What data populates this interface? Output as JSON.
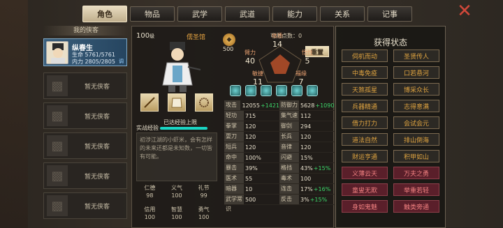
{
  "tabs": [
    "角色",
    "物品",
    "武学",
    "武道",
    "能力",
    "关系",
    "记事"
  ],
  "close_icon": "close-icon",
  "left": {
    "title": "我的侠客",
    "hero": {
      "name": "纵春生",
      "hp": "生命 5761/5761",
      "mp": "内力 2805/2805",
      "tag": "调"
    },
    "empty_label": "暂无侠客"
  },
  "center": {
    "level": "100",
    "level_unit": "级",
    "title": "儒圣馆",
    "exp_label": "实战经验",
    "exp_text": "已达经验上限",
    "exp_progress": 1.0,
    "bio": "初涉江湖的小虾米，会有怎样的未来还都是未知数，一切皆有可能。",
    "virtues": [
      {
        "name": "仁德",
        "value": "98"
      },
      {
        "name": "义气",
        "value": "100"
      },
      {
        "name": "礼节",
        "value": "99"
      },
      {
        "name": "信用",
        "value": "100"
      },
      {
        "name": "智慧",
        "value": "100"
      },
      {
        "name": "勇气",
        "value": "100"
      }
    ],
    "coin": "500",
    "points_label": "可用点数：",
    "points": "0",
    "reset_label": "重置",
    "attrs": {
      "tizhi": {
        "name": "体质",
        "value": "14"
      },
      "biili": {
        "name": "臂力",
        "value": "40"
      },
      "wuxing": {
        "name": "悟性",
        "value": "5"
      },
      "minjie": {
        "name": "敏捷",
        "value": "11"
      },
      "fuyuan": {
        "name": "福缘",
        "value": "7"
      }
    },
    "stats": [
      [
        {
          "k": "攻击力",
          "v": "12055",
          "up": "+1421"
        },
        {
          "k": "防御力",
          "v": "5628",
          "up": "+1090"
        }
      ],
      [
        {
          "k": "轻功",
          "v": "715",
          "up": ""
        },
        {
          "k": "集气速度",
          "v": "112",
          "up": ""
        }
      ],
      [
        {
          "k": "拳掌",
          "v": "120",
          "up": ""
        },
        {
          "k": "御剑",
          "v": "294",
          "up": ""
        }
      ],
      [
        {
          "k": "耍刀",
          "v": "120",
          "up": ""
        },
        {
          "k": "长兵",
          "v": "120",
          "up": ""
        }
      ],
      [
        {
          "k": "短兵",
          "v": "120",
          "up": ""
        },
        {
          "k": "音律",
          "v": "120",
          "up": ""
        }
      ],
      [
        {
          "k": "命中",
          "v": "100%",
          "up": ""
        },
        {
          "k": "闪避",
          "v": "15%",
          "up": ""
        }
      ],
      [
        {
          "k": "暴击",
          "v": "39%",
          "up": ""
        },
        {
          "k": "格挡",
          "v": "43%",
          "up": "+15%"
        }
      ],
      [
        {
          "k": "医术",
          "v": "55",
          "up": ""
        },
        {
          "k": "毒术",
          "v": "100",
          "up": ""
        }
      ],
      [
        {
          "k": "暗器",
          "v": "10",
          "up": ""
        },
        {
          "k": "连击",
          "v": "17%",
          "up": "+16%"
        }
      ],
      [
        {
          "k": "武学常识",
          "v": "500",
          "up": ""
        },
        {
          "k": "反击",
          "v": "3%",
          "up": "+15%"
        }
      ]
    ]
  },
  "right": {
    "title": "获得状态",
    "items": [
      {
        "label": "伺机而动",
        "alt": false
      },
      {
        "label": "圣贤传人",
        "alt": false
      },
      {
        "label": "中毒免疫",
        "alt": false
      },
      {
        "label": "口若悬河",
        "alt": false
      },
      {
        "label": "天煞孤星",
        "alt": false
      },
      {
        "label": "博采众长",
        "alt": false
      },
      {
        "label": "兵器精通",
        "alt": false
      },
      {
        "label": "志得意满",
        "alt": false
      },
      {
        "label": "借力打力",
        "alt": false
      },
      {
        "label": "会试会元",
        "alt": false
      },
      {
        "label": "道法自然",
        "alt": false
      },
      {
        "label": "排山倒海",
        "alt": false
      },
      {
        "label": "财运亨通",
        "alt": false
      },
      {
        "label": "积甲如山",
        "alt": false
      },
      {
        "label": "义薄云天",
        "alt": true
      },
      {
        "label": "万夫之勇",
        "alt": true
      },
      {
        "label": "童叟无欺",
        "alt": true
      },
      {
        "label": "举重若轻",
        "alt": true
      },
      {
        "label": "身如鬼魅",
        "alt": true
      },
      {
        "label": "触类旁通",
        "alt": true
      }
    ]
  }
}
